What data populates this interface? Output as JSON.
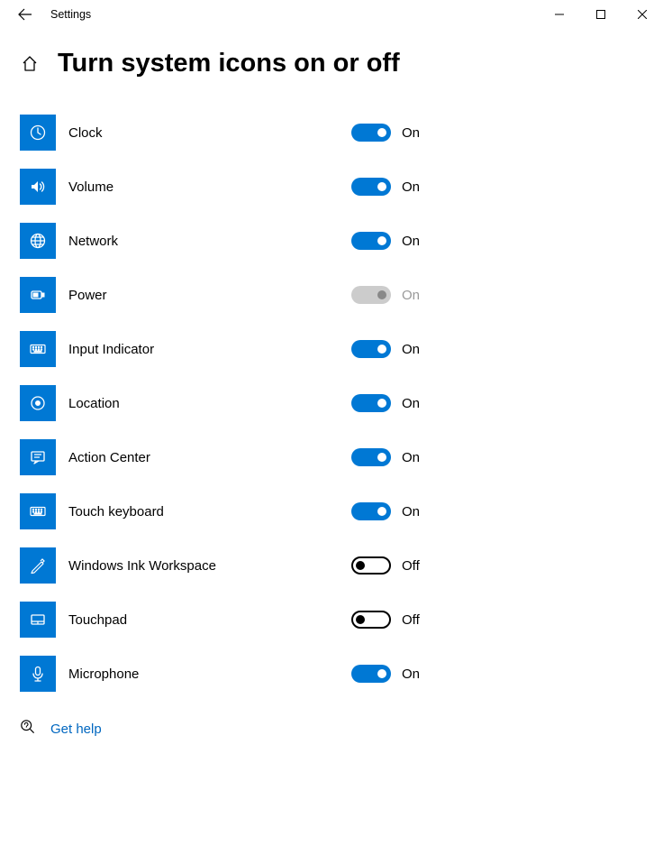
{
  "titlebar": {
    "title": "Settings"
  },
  "page": {
    "title": "Turn system icons on or off"
  },
  "toggle_labels": {
    "on": "On",
    "off": "Off"
  },
  "settings": [
    {
      "icon": "clock",
      "label": "Clock",
      "state": "on"
    },
    {
      "icon": "volume",
      "label": "Volume",
      "state": "on"
    },
    {
      "icon": "network",
      "label": "Network",
      "state": "on"
    },
    {
      "icon": "power",
      "label": "Power",
      "state": "disabled"
    },
    {
      "icon": "keyboard",
      "label": "Input Indicator",
      "state": "on"
    },
    {
      "icon": "location",
      "label": "Location",
      "state": "on"
    },
    {
      "icon": "action",
      "label": "Action Center",
      "state": "on"
    },
    {
      "icon": "keyboard",
      "label": "Touch keyboard",
      "state": "on"
    },
    {
      "icon": "ink",
      "label": "Windows Ink Workspace",
      "state": "off"
    },
    {
      "icon": "touchpad",
      "label": "Touchpad",
      "state": "off"
    },
    {
      "icon": "microphone",
      "label": "Microphone",
      "state": "on"
    }
  ],
  "help": {
    "label": "Get help"
  }
}
